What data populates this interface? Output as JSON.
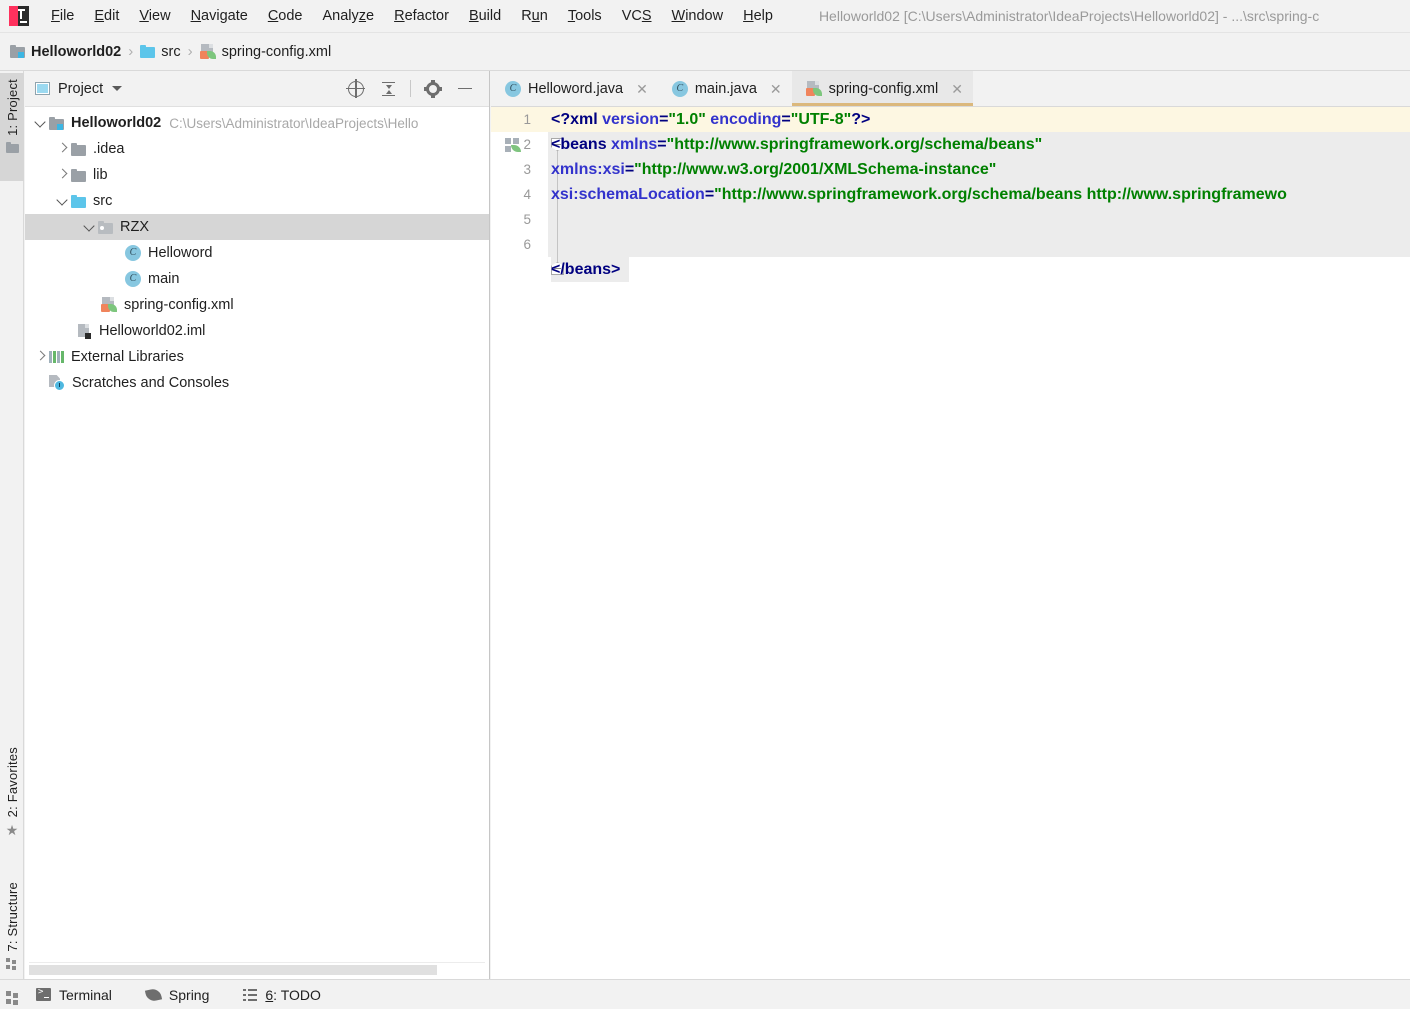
{
  "window": {
    "title": "Helloworld02 [C:\\Users\\Administrator\\IdeaProjects\\Helloworld02] - ...\\src\\spring-c",
    "logo_icon": "intellij-idea-logo"
  },
  "menubar": {
    "items": [
      {
        "label": "File",
        "mnemonic": "F"
      },
      {
        "label": "Edit",
        "mnemonic": "E"
      },
      {
        "label": "View",
        "mnemonic": "V"
      },
      {
        "label": "Navigate",
        "mnemonic": "N"
      },
      {
        "label": "Code",
        "mnemonic": "C"
      },
      {
        "label": "Analyze",
        "mnemonic": "z"
      },
      {
        "label": "Refactor",
        "mnemonic": "R"
      },
      {
        "label": "Build",
        "mnemonic": "B"
      },
      {
        "label": "Run",
        "mnemonic": "u"
      },
      {
        "label": "Tools",
        "mnemonic": "T"
      },
      {
        "label": "VCS",
        "mnemonic": "S"
      },
      {
        "label": "Window",
        "mnemonic": "W"
      },
      {
        "label": "Help",
        "mnemonic": "H"
      }
    ]
  },
  "breadcrumb": {
    "items": [
      {
        "label": "Helloworld02",
        "icon": "module-icon",
        "bold": true
      },
      {
        "label": "src",
        "icon": "source-folder-icon",
        "bold": false
      },
      {
        "label": "spring-config.xml",
        "icon": "xml-spring-file-icon",
        "bold": false
      }
    ],
    "separator": "›"
  },
  "left_strip": {
    "tabs": [
      {
        "label": "1: Project",
        "icon": "folder-icon",
        "active": true
      },
      {
        "label": "2: Favorites",
        "icon": "star-icon",
        "active": false
      },
      {
        "label": "7: Structure",
        "icon": "structure-grid-icon",
        "active": false
      }
    ]
  },
  "project_panel": {
    "title": "Project",
    "panel_icon": "project-view-icon",
    "dropdown_icon": "chevron-down-icon",
    "tools": [
      {
        "name": "locate-icon",
        "label": "Select Opened File"
      },
      {
        "name": "collapse-all-icon",
        "label": "Collapse All"
      },
      {
        "name": "gear-icon",
        "label": "Settings"
      },
      {
        "name": "minimize-icon",
        "label": "Hide"
      }
    ],
    "tree": [
      {
        "label": "Helloworld02",
        "path": "C:\\Users\\Administrator\\IdeaProjects\\Hello",
        "icon": "module-icon",
        "indent": 0,
        "twist": "down",
        "bold": true,
        "selected": false
      },
      {
        "label": ".idea",
        "path": "",
        "icon": "folder-icon",
        "indent": 1,
        "twist": "right",
        "bold": false,
        "selected": false
      },
      {
        "label": "lib",
        "path": "",
        "icon": "folder-icon",
        "indent": 1,
        "twist": "right",
        "bold": false,
        "selected": false
      },
      {
        "label": "src",
        "path": "",
        "icon": "source-folder-icon",
        "indent": 1,
        "twist": "down",
        "bold": false,
        "selected": false
      },
      {
        "label": "RZX",
        "path": "",
        "icon": "package-folder-icon",
        "indent": 2,
        "twist": "down",
        "bold": false,
        "selected": true
      },
      {
        "label": "Helloword",
        "path": "",
        "icon": "java-class-icon",
        "indent": 3,
        "twist": "none",
        "bold": false,
        "selected": false
      },
      {
        "label": "main",
        "path": "",
        "icon": "java-class-icon",
        "indent": 3,
        "twist": "none",
        "bold": false,
        "selected": false
      },
      {
        "label": "spring-config.xml",
        "path": "",
        "icon": "xml-spring-file-icon",
        "indent": 2,
        "twist": "none",
        "bold": false,
        "selected": false
      },
      {
        "label": "Helloworld02.iml",
        "path": "",
        "icon": "iml-file-icon",
        "indent": 1,
        "twist": "none",
        "bold": false,
        "selected": false
      },
      {
        "label": "External Libraries",
        "path": "",
        "icon": "libraries-icon",
        "indent": 0,
        "twist": "right",
        "bold": false,
        "selected": false
      },
      {
        "label": "Scratches and Consoles",
        "path": "",
        "icon": "scratches-icon",
        "indent": 0,
        "twist": "none",
        "bold": false,
        "selected": false
      }
    ]
  },
  "editor": {
    "tabs": [
      {
        "label": "Helloword.java",
        "icon": "java-class-icon",
        "active": false,
        "close_icon": "close-icon"
      },
      {
        "label": "main.java",
        "icon": "java-class-icon",
        "active": false,
        "close_icon": "close-icon"
      },
      {
        "label": "spring-config.xml",
        "icon": "xml-spring-file-icon",
        "active": true,
        "close_icon": "close-icon"
      }
    ],
    "active_tab_underline_color": "#dbb87c",
    "caret_line_color": "#fdf7e2",
    "block_highlight_color": "#ececec",
    "lines": [
      {
        "num": "1",
        "text": "<?xml version=\"1.0\" encoding=\"UTF-8\"?>"
      },
      {
        "num": "2",
        "text": "<beans xmlns=\"http://www.springframework.org/schema/beans\""
      },
      {
        "num": "3",
        "text": "       xmlns:xsi=\"http://www.w3.org/2001/XMLSchema-instance\""
      },
      {
        "num": "4",
        "text": "       xsi:schemaLocation=\"http://www.springframework.org/schema/beans http://www.springframewo"
      },
      {
        "num": "5",
        "text": ""
      },
      {
        "num": "6",
        "text": "</beans>"
      }
    ],
    "gutter_icons": [
      {
        "line": "2",
        "name": "spring-bean-gutter-icon"
      }
    ]
  },
  "statusbar": {
    "items": [
      {
        "label": "Terminal",
        "icon": "terminal-icon",
        "mnemonic": ""
      },
      {
        "label": "Spring",
        "icon": "spring-leaf-icon",
        "mnemonic": ""
      },
      {
        "label": "6: TODO",
        "icon": "todo-list-icon",
        "mnemonic": "6"
      }
    ]
  }
}
